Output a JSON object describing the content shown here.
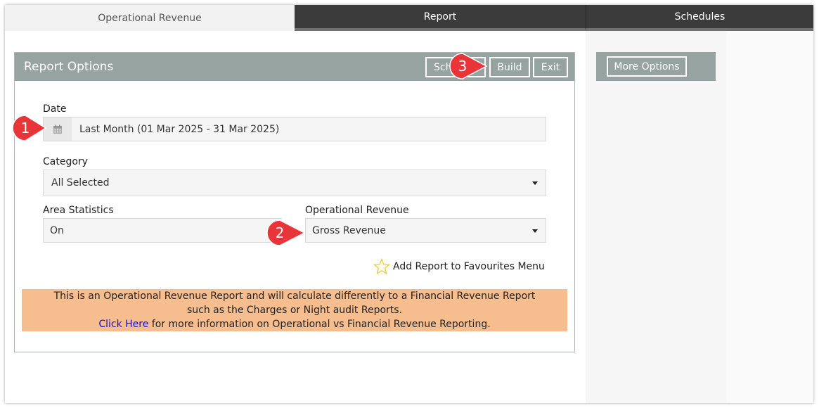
{
  "tabs": [
    {
      "label": "Operational Revenue"
    },
    {
      "label": "Report"
    },
    {
      "label": "Schedules"
    }
  ],
  "panel": {
    "title": "Report Options",
    "buttons": {
      "schedule": "Sch",
      "build": "Build",
      "exit": "Exit"
    }
  },
  "form": {
    "date_label": "Date",
    "date_value": "Last Month (01 Mar 2025 - 31 Mar 2025)",
    "category_label": "Category",
    "category_value": "All Selected",
    "area_stats_label": "Area Statistics",
    "area_stats_value": "On",
    "op_revenue_label": "Operational Revenue",
    "op_revenue_value": "Gross Revenue",
    "favourites_label": "Add Report to Favourites Menu"
  },
  "notice": {
    "line1": "This is an Operational Revenue Report and will calculate differently to a Financial Revenue Report",
    "line2": "such as the Charges or Night audit Reports.",
    "link": "Click Here",
    "line3_rest": " for more information on Operational vs Financial Revenue Reporting."
  },
  "side": {
    "more_options": "More Options"
  },
  "markers": [
    "1",
    "2",
    "3"
  ],
  "colors": {
    "header_gray": "#96a3a1",
    "tab_dark": "#3b3b3b",
    "notice_orange": "#f6bd8f",
    "marker_red": "#e8353a",
    "link_blue": "#1a0dcc"
  }
}
